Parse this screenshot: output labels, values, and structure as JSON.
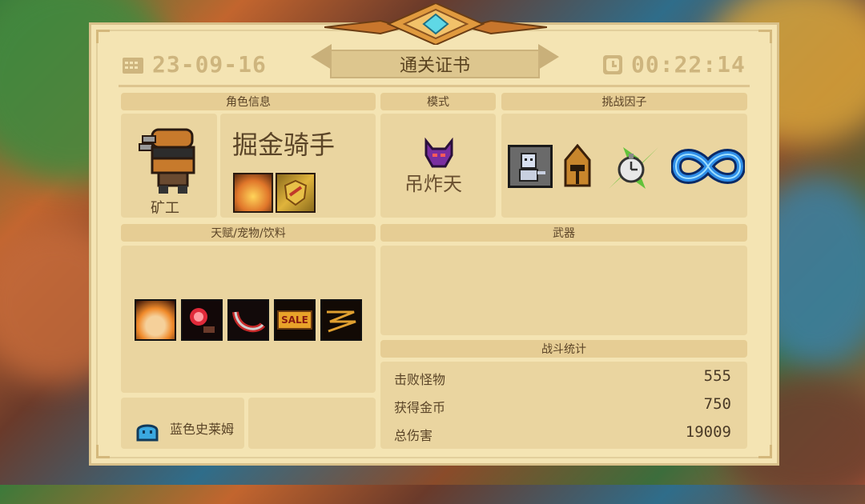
{
  "header": {
    "date": "23-09-16",
    "title": "通关证书",
    "time": "00:22:14"
  },
  "sections": {
    "character_info": "角色信息",
    "mode": "模式",
    "challenge_factors": "挑战因子",
    "talents": "天赋/宠物/饮料",
    "weapons": "武器",
    "battle_stats": "战斗统计"
  },
  "character": {
    "name": "掘金骑手",
    "class": "矿工",
    "icon": "miner-knight-icon"
  },
  "mode": {
    "name": "吊炸天",
    "icon": "purple-demon-mask-icon"
  },
  "challenge_factors": [
    {
      "icon": "robot-figure-icon"
    },
    {
      "icon": "golden-helmet-icon"
    },
    {
      "icon": "stopwatch-icon"
    },
    {
      "icon": "infinity-icon"
    }
  ],
  "talent_icons": [
    {
      "icon": "burning-hamster-icon"
    },
    {
      "icon": "red-orb-icon"
    },
    {
      "icon": "blade-slash-icon"
    },
    {
      "icon": "sale-tag-icon",
      "text": "SALE"
    },
    {
      "icon": "zigzag-icon"
    }
  ],
  "pet": {
    "name": "蓝色史莱姆",
    "icon": "blue-slime-icon"
  },
  "stats": [
    {
      "label": "击败怪物",
      "value": "555"
    },
    {
      "label": "获得金币",
      "value": "750"
    },
    {
      "label": "总伤害",
      "value": "19009"
    }
  ],
  "colors": {
    "parchment": "#f4e4b3",
    "panel": "#ead5a0",
    "accent_gold": "#ceb57e",
    "text_brown": "#5a4427"
  }
}
